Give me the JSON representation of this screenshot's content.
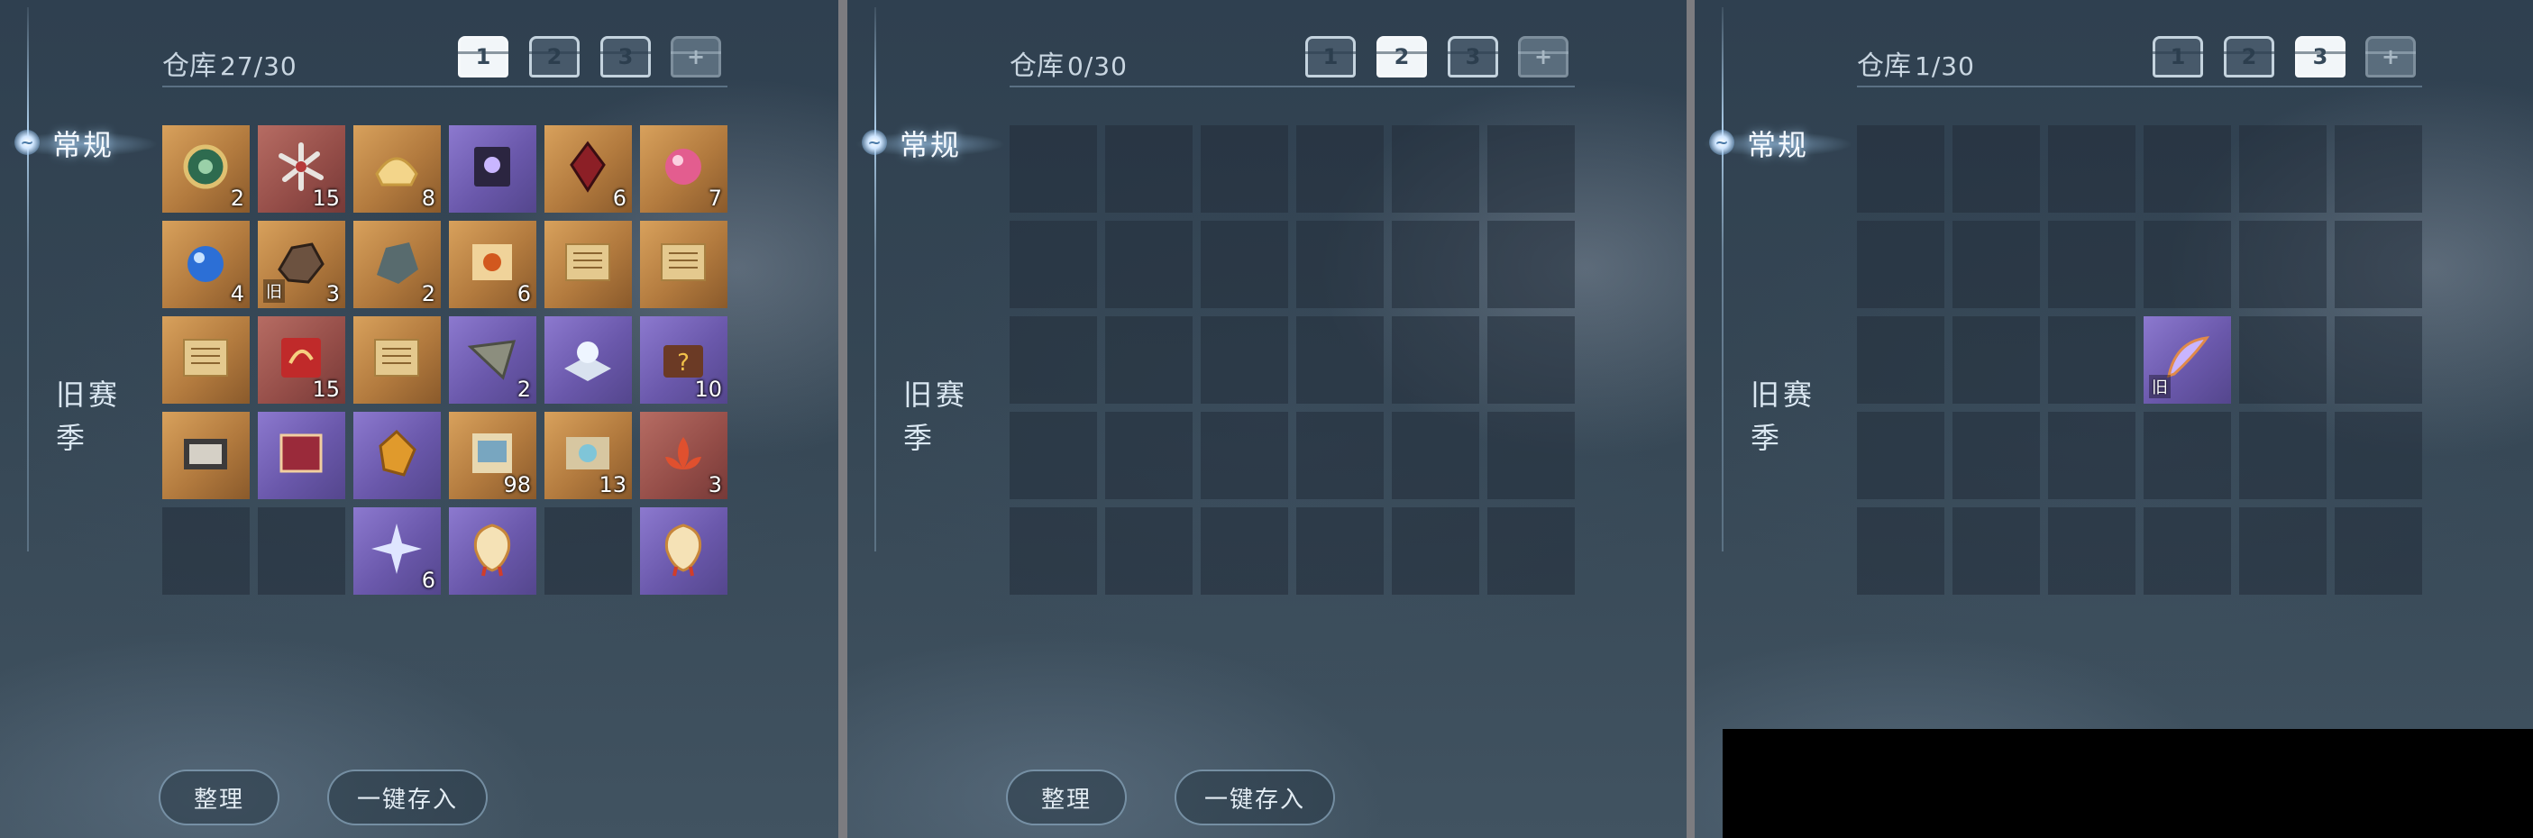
{
  "panels": [
    {
      "sidebar": {
        "tab_regular": "常规",
        "tab_old_season": "旧赛季"
      },
      "header": {
        "storage_label": "仓库",
        "count": "27/30",
        "chests": [
          {
            "label": "1",
            "state": "active"
          },
          {
            "label": "2",
            "state": "normal"
          },
          {
            "label": "3",
            "state": "normal"
          },
          {
            "label": "",
            "state": "locked"
          }
        ]
      },
      "buttons": {
        "sort": "整理",
        "deposit_all": "一键存入"
      },
      "slots": [
        {
          "item": "jade-pendant-icon",
          "rarity": "gold",
          "qty": "2"
        },
        {
          "item": "shuriken-icon",
          "rarity": "red",
          "qty": "15"
        },
        {
          "item": "gold-ingot-icon",
          "rarity": "gold",
          "qty": "8"
        },
        {
          "item": "dark-book-icon",
          "rarity": "purple",
          "qty": ""
        },
        {
          "item": "red-crystal-icon",
          "rarity": "gold",
          "qty": "6"
        },
        {
          "item": "pink-orb-icon",
          "rarity": "gold",
          "qty": "7"
        },
        {
          "item": "blue-gem-icon",
          "rarity": "gold",
          "qty": "4"
        },
        {
          "item": "ore-icon",
          "rarity": "gold",
          "qty": "3",
          "tag": "旧"
        },
        {
          "item": "stone-icon",
          "rarity": "gold",
          "qty": "2"
        },
        {
          "item": "fire-scroll-icon",
          "rarity": "gold",
          "qty": "6"
        },
        {
          "item": "scroll-icon",
          "rarity": "gold",
          "qty": ""
        },
        {
          "item": "scroll-icon",
          "rarity": "gold",
          "qty": ""
        },
        {
          "item": "scroll-icon",
          "rarity": "gold",
          "qty": ""
        },
        {
          "item": "red-talisman-icon",
          "rarity": "red",
          "qty": "15"
        },
        {
          "item": "scroll-icon",
          "rarity": "gold",
          "qty": ""
        },
        {
          "item": "grey-fragment-icon",
          "rarity": "purple",
          "qty": "2"
        },
        {
          "item": "pearl-icon",
          "rarity": "purple",
          "qty": ""
        },
        {
          "item": "mystery-box-icon",
          "rarity": "purple",
          "qty": "10"
        },
        {
          "item": "tome-icon",
          "rarity": "gold",
          "qty": ""
        },
        {
          "item": "red-book-icon",
          "rarity": "purple",
          "qty": ""
        },
        {
          "item": "amber-icon",
          "rarity": "purple",
          "qty": ""
        },
        {
          "item": "manual-icon",
          "rarity": "gold",
          "qty": "98"
        },
        {
          "item": "map-icon",
          "rarity": "gold",
          "qty": "13"
        },
        {
          "item": "lotus-icon",
          "rarity": "red",
          "qty": "3"
        },
        {
          "item": "",
          "rarity": "empty",
          "qty": ""
        },
        {
          "item": "",
          "rarity": "empty",
          "qty": ""
        },
        {
          "item": "star-shard-icon",
          "rarity": "purple",
          "qty": "6"
        },
        {
          "item": "fortune-charm-icon",
          "rarity": "purple",
          "qty": ""
        },
        {
          "item": "",
          "rarity": "empty",
          "qty": ""
        },
        {
          "item": "fortune-charm-icon",
          "rarity": "purple",
          "qty": ""
        }
      ]
    },
    {
      "sidebar": {
        "tab_regular": "常规",
        "tab_old_season": "旧赛季"
      },
      "header": {
        "storage_label": "仓库",
        "count": "0/30",
        "chests": [
          {
            "label": "1",
            "state": "normal"
          },
          {
            "label": "2",
            "state": "active"
          },
          {
            "label": "3",
            "state": "normal"
          },
          {
            "label": "",
            "state": "locked"
          }
        ]
      },
      "buttons": {
        "sort": "整理",
        "deposit_all": "一键存入"
      },
      "slots": []
    },
    {
      "sidebar": {
        "tab_regular": "常规",
        "tab_old_season": "旧赛季"
      },
      "header": {
        "storage_label": "仓库",
        "count": "1/30",
        "chests": [
          {
            "label": "1",
            "state": "normal"
          },
          {
            "label": "2",
            "state": "normal"
          },
          {
            "label": "3",
            "state": "active"
          },
          {
            "label": "",
            "state": "locked"
          }
        ]
      },
      "buttons": {},
      "slots": [
        {
          "item": "",
          "rarity": "empty",
          "qty": ""
        },
        {
          "item": "",
          "rarity": "empty",
          "qty": ""
        },
        {
          "item": "",
          "rarity": "empty",
          "qty": ""
        },
        {
          "item": "",
          "rarity": "empty",
          "qty": ""
        },
        {
          "item": "",
          "rarity": "empty",
          "qty": ""
        },
        {
          "item": "",
          "rarity": "empty",
          "qty": ""
        },
        {
          "item": "",
          "rarity": "empty",
          "qty": ""
        },
        {
          "item": "",
          "rarity": "empty",
          "qty": ""
        },
        {
          "item": "",
          "rarity": "empty",
          "qty": ""
        },
        {
          "item": "",
          "rarity": "empty",
          "qty": ""
        },
        {
          "item": "",
          "rarity": "empty",
          "qty": ""
        },
        {
          "item": "",
          "rarity": "empty",
          "qty": ""
        },
        {
          "item": "",
          "rarity": "empty",
          "qty": ""
        },
        {
          "item": "",
          "rarity": "empty",
          "qty": ""
        },
        {
          "item": "",
          "rarity": "empty",
          "qty": ""
        },
        {
          "item": "feather-icon",
          "rarity": "purple",
          "qty": "",
          "tag": "旧"
        },
        {
          "item": "",
          "rarity": "empty",
          "qty": ""
        },
        {
          "item": "",
          "rarity": "empty",
          "qty": ""
        }
      ]
    }
  ]
}
